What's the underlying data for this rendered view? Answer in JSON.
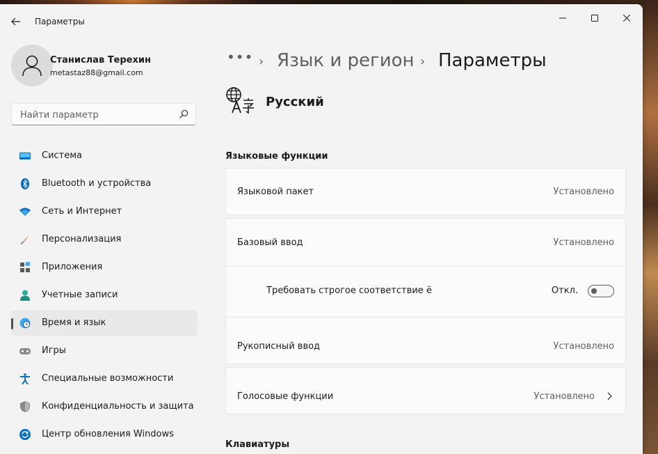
{
  "window": {
    "title": "Параметры",
    "controls": [
      "minimize-icon",
      "maximize-icon",
      "close-icon"
    ]
  },
  "user": {
    "name": "Станислав Терехин",
    "email": "metastaz88@gmail.com"
  },
  "search": {
    "placeholder": "Найти параметр"
  },
  "sidebar": {
    "items": [
      {
        "label": "Система",
        "icon": "monitor-icon"
      },
      {
        "label": "Bluetooth и устройства",
        "icon": "bluetooth-icon"
      },
      {
        "label": "Сеть и Интернет",
        "icon": "wifi-icon"
      },
      {
        "label": "Персонализация",
        "icon": "brush-icon"
      },
      {
        "label": "Приложения",
        "icon": "apps-icon"
      },
      {
        "label": "Учетные записи",
        "icon": "person-icon"
      },
      {
        "label": "Время и язык",
        "icon": "globe-clock-icon",
        "active": true
      },
      {
        "label": "Игры",
        "icon": "gamepad-icon"
      },
      {
        "label": "Специальные возможности",
        "icon": "accessibility-icon"
      },
      {
        "label": "Конфиденциальность и защита",
        "icon": "shield-icon"
      },
      {
        "label": "Центр обновления Windows",
        "icon": "update-icon"
      }
    ]
  },
  "breadcrumb": {
    "more": "•••",
    "separator": "›",
    "parent": "Язык и регион",
    "current": "Параметры"
  },
  "language": {
    "name": "Русский",
    "icon": "language-icon"
  },
  "sections": {
    "features_title": "Языковые функции",
    "keyboards_title": "Клавиатуры"
  },
  "features": [
    {
      "label": "Языковой пакет",
      "value": "Установлено"
    },
    {
      "label": "Базовый ввод",
      "value": "Установлено"
    },
    {
      "label": "Требовать строгое соответствие ё",
      "value": "Откл.",
      "toggle": false
    },
    {
      "label": "Рукописный ввод",
      "value": "Установлено"
    },
    {
      "label": "Голосовые функции",
      "value": "Установлено",
      "chevron": true
    }
  ],
  "colors": {
    "accent": "#0067c0",
    "window_bg": "#f3f3f3",
    "card_bg": "#fbfbfb"
  }
}
